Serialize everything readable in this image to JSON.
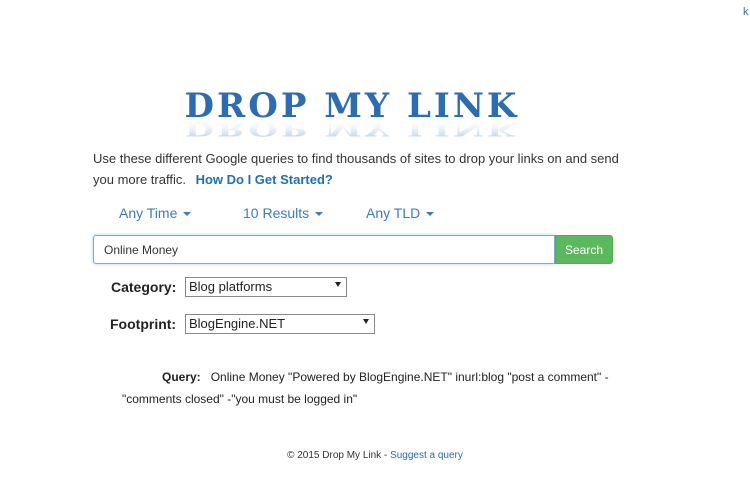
{
  "corner": {
    "text": "k"
  },
  "logo": {
    "text": "DROP MY LINK"
  },
  "intro": {
    "text": "Use these different Google queries to find thousands of sites to drop your links on and send you more traffic.",
    "link": "How Do I Get Started?"
  },
  "filters": [
    {
      "label": "Any Time"
    },
    {
      "label": "10 Results"
    },
    {
      "label": "Any TLD"
    }
  ],
  "search": {
    "value": "Online Money",
    "button": "Search"
  },
  "category": {
    "label": "Category:",
    "selected": "Blog platforms"
  },
  "footprint": {
    "label": "Footprint:",
    "selected": "BlogEngine.NET"
  },
  "query": {
    "label": "Query:",
    "text": "Online Money \"Powered by BlogEngine.NET\" inurl:blog \"post a comment\" -\"comments closed\" -\"you must be logged in\""
  },
  "footer": {
    "copyright": "© 2015 Drop My Link - ",
    "link": "Suggest a query"
  },
  "colors": {
    "accent": "#3a7bbf",
    "search_button": "#5cb85c",
    "logo_blue": "#2b6cb3"
  }
}
